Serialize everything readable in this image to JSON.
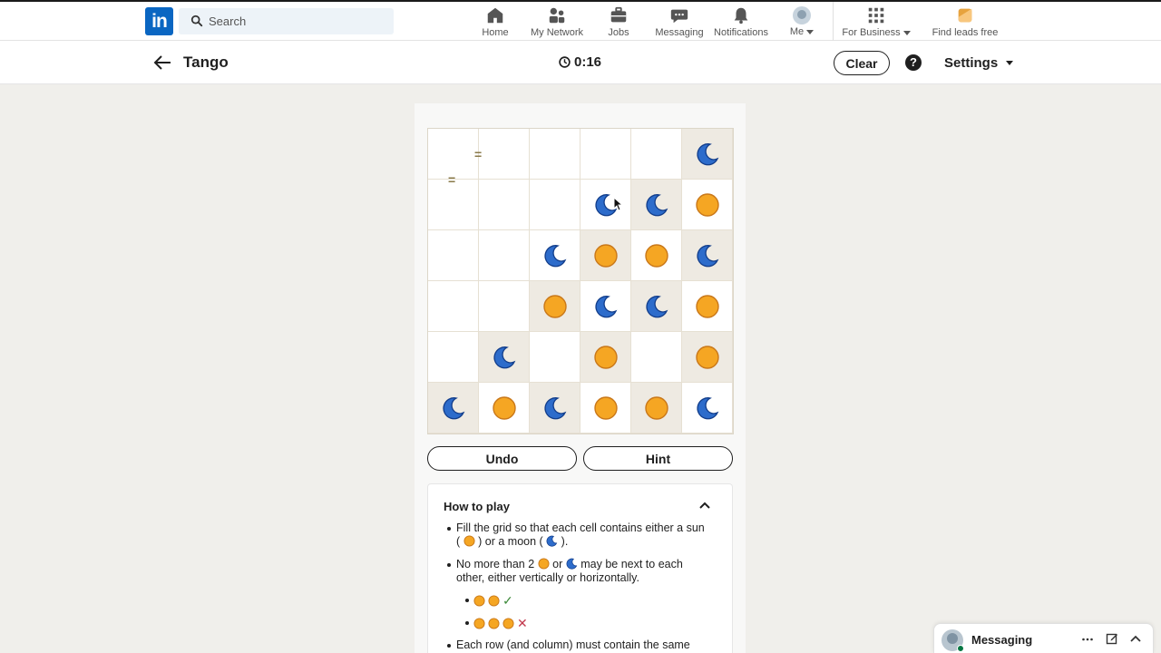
{
  "nav": {
    "search_placeholder": "Search",
    "items": [
      {
        "label": "Home",
        "icon": "home-icon"
      },
      {
        "label": "My Network",
        "icon": "network-icon"
      },
      {
        "label": "Jobs",
        "icon": "briefcase-icon"
      },
      {
        "label": "Messaging",
        "icon": "messaging-icon"
      },
      {
        "label": "Notifications",
        "icon": "bell-icon"
      },
      {
        "label": "Me",
        "icon": "avatar"
      },
      {
        "label": "For Business",
        "icon": "grid-icon"
      },
      {
        "label": "Find leads free",
        "icon": "leads-icon"
      }
    ],
    "brand_color": "#0a66c2"
  },
  "game": {
    "title": "Tango",
    "timer": "0:16",
    "clear_label": "Clear",
    "help_label": "?",
    "settings_label": "Settings",
    "undo_label": "Undo",
    "hint_label": "Hint",
    "sun_color": "#f5a623",
    "moon_color": "#2d6ccb",
    "grid": [
      [
        "",
        "",
        "",
        "",
        "",
        "moon"
      ],
      [
        "",
        "",
        "",
        "moon",
        "moon",
        "sun"
      ],
      [
        "",
        "",
        "moon",
        "sun",
        "sun",
        "moon"
      ],
      [
        "",
        "",
        "sun",
        "moon",
        "moon",
        "sun"
      ],
      [
        "",
        "moon",
        "",
        "sun",
        "",
        "sun"
      ],
      [
        "moon",
        "sun",
        "moon",
        "sun",
        "sun",
        "moon"
      ]
    ],
    "locked": [
      [
        0,
        0,
        0,
        0,
        0,
        1
      ],
      [
        0,
        0,
        0,
        0,
        1,
        0
      ],
      [
        0,
        0,
        0,
        1,
        0,
        1
      ],
      [
        0,
        0,
        1,
        0,
        1,
        0
      ],
      [
        0,
        1,
        0,
        1,
        0,
        1
      ],
      [
        1,
        0,
        1,
        0,
        1,
        0
      ]
    ],
    "constraints": [
      {
        "symbol": "="
      },
      {
        "symbol": "="
      }
    ]
  },
  "howto": {
    "title": "How to play",
    "rule1_a": "Fill the grid so that each cell contains either a sun",
    "rule1_b1": "(",
    "rule1_b2": ") or a moon (",
    "rule1_b3": ").",
    "rule2_a1": "No more than 2",
    "rule2_a2": "or",
    "rule2_a3": "may be next to each",
    "rule2_b": "other, either vertically or horizontally.",
    "ok_mark": "✓",
    "bad_mark": "✕",
    "rule3": "Each row (and column) must contain the same"
  },
  "messaging": {
    "label": "Messaging"
  }
}
